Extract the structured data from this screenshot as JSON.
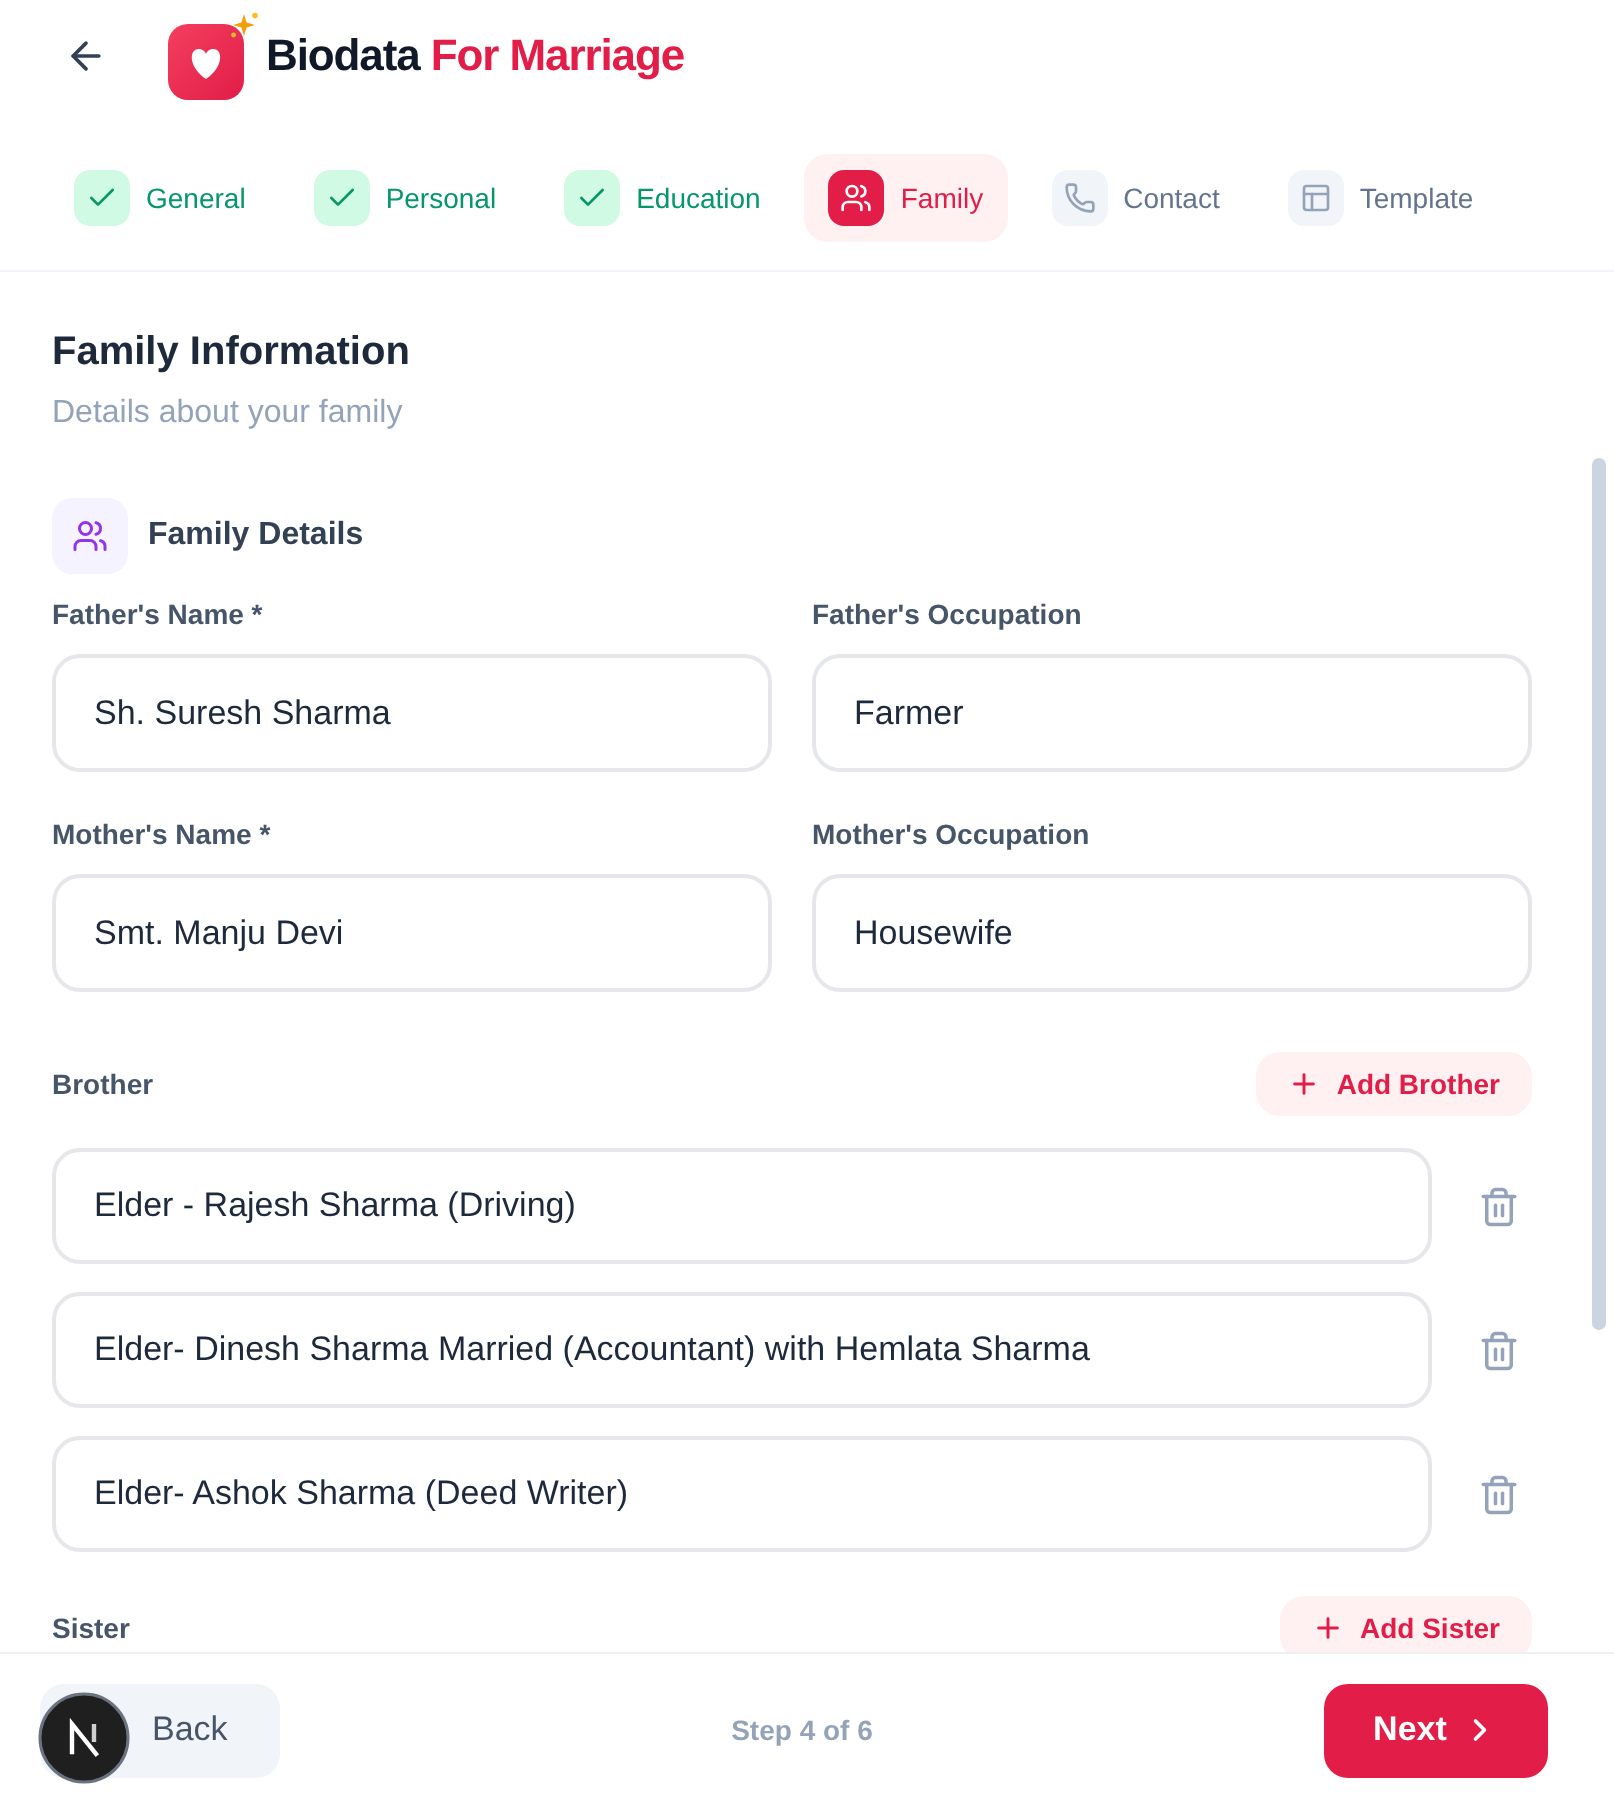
{
  "header": {
    "title": "Biodata",
    "title_highlight": "For Marriage"
  },
  "steps": [
    {
      "label": "General",
      "completed": true,
      "selected": false
    },
    {
      "label": "Personal",
      "completed": true,
      "selected": false
    },
    {
      "label": "Education",
      "completed": true,
      "selected": false
    },
    {
      "label": "Family",
      "completed": false,
      "selected": true
    },
    {
      "label": "Contact",
      "completed": false,
      "selected": false
    },
    {
      "label": "Template",
      "completed": false,
      "selected": false
    }
  ],
  "section": {
    "title": "Family Information",
    "subtitle": "Details about your family"
  },
  "family_details": {
    "heading": "Family Details",
    "fields": [
      {
        "label": "Father's Name *",
        "value": "Sh. Suresh Sharma"
      },
      {
        "label": "Father's Occupation",
        "value": "Farmer"
      },
      {
        "label": "Mother's Name *",
        "value": "Smt. Manju Devi"
      },
      {
        "label": "Mother's Occupation",
        "value": "Housewife"
      }
    ]
  },
  "brothers": {
    "label": "Brother",
    "add_button": "Add Brother",
    "entries": [
      {
        "value": "Elder - Rajesh Sharma (Driving)"
      },
      {
        "value": "Elder- Dinesh Sharma Married (Accountant) with Hemlata Sharma"
      },
      {
        "value": "Elder- Ashok Sharma (Deed Writer)"
      }
    ]
  },
  "sisters": {
    "label": "Sister",
    "add_button": "Add Sister"
  },
  "footer": {
    "back": "Back",
    "step": "Step 4 of 6",
    "next": "Next"
  }
}
